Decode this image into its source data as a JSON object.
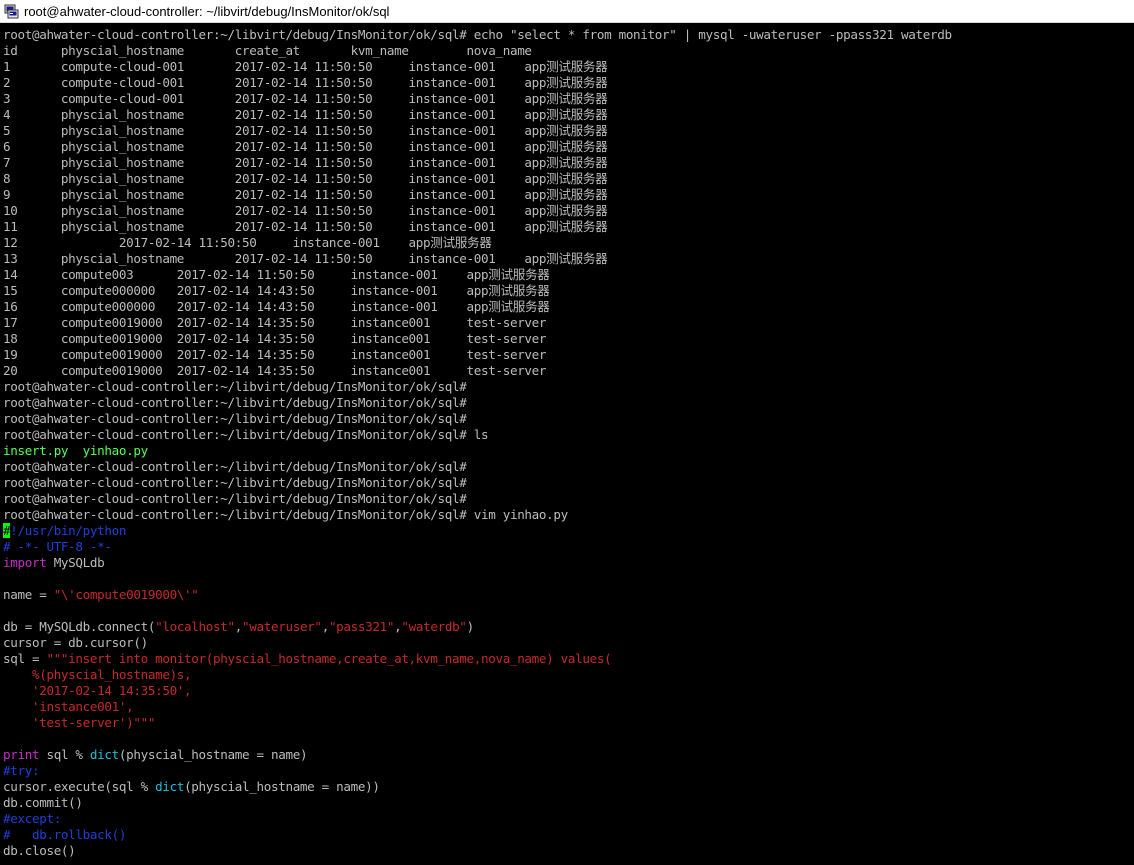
{
  "window": {
    "title": "root@ahwater-cloud-controller: ~/libvirt/debug/InsMonitor/ok/sql",
    "icon": "putty-terminal-icon"
  },
  "colors": {
    "background": "#000000",
    "default": "#bbbbbb",
    "green": "#54ff54",
    "comment": "#1f3fd6",
    "keyword": "#c42fc4",
    "string": "#c42a2a",
    "builtin": "#20bcd6",
    "cursor": "#00ff00"
  },
  "terminal": {
    "lines": [
      [
        {
          "t": "root@ahwater-cloud-controller:~/libvirt/debug/InsMonitor/ok/sql# echo \"select * from monitor\" | mysql -uwateruser -ppass321 waterdb",
          "c": "default"
        }
      ],
      [
        {
          "t": "id      physcial_hostname       create_at       kvm_name        nova_name",
          "c": "default"
        }
      ],
      [
        {
          "t": "1       compute-cloud-001       2017-02-14 11:50:50     instance-001    app测试服务器",
          "c": "default"
        }
      ],
      [
        {
          "t": "2       compute-cloud-001       2017-02-14 11:50:50     instance-001    app测试服务器",
          "c": "default"
        }
      ],
      [
        {
          "t": "3       compute-cloud-001       2017-02-14 11:50:50     instance-001    app测试服务器",
          "c": "default"
        }
      ],
      [
        {
          "t": "4       physcial_hostname       2017-02-14 11:50:50     instance-001    app测试服务器",
          "c": "default"
        }
      ],
      [
        {
          "t": "5       physcial_hostname       2017-02-14 11:50:50     instance-001    app测试服务器",
          "c": "default"
        }
      ],
      [
        {
          "t": "6       physcial_hostname       2017-02-14 11:50:50     instance-001    app测试服务器",
          "c": "default"
        }
      ],
      [
        {
          "t": "7       physcial_hostname       2017-02-14 11:50:50     instance-001    app测试服务器",
          "c": "default"
        }
      ],
      [
        {
          "t": "8       physcial_hostname       2017-02-14 11:50:50     instance-001    app测试服务器",
          "c": "default"
        }
      ],
      [
        {
          "t": "9       physcial_hostname       2017-02-14 11:50:50     instance-001    app测试服务器",
          "c": "default"
        }
      ],
      [
        {
          "t": "10      physcial_hostname       2017-02-14 11:50:50     instance-001    app测试服务器",
          "c": "default"
        }
      ],
      [
        {
          "t": "11      physcial_hostname       2017-02-14 11:50:50     instance-001    app测试服务器",
          "c": "default"
        }
      ],
      [
        {
          "t": "12              2017-02-14 11:50:50     instance-001    app测试服务器",
          "c": "default"
        }
      ],
      [
        {
          "t": "13      physcial_hostname       2017-02-14 11:50:50     instance-001    app测试服务器",
          "c": "default"
        }
      ],
      [
        {
          "t": "14      compute003      2017-02-14 11:50:50     instance-001    app测试服务器",
          "c": "default"
        }
      ],
      [
        {
          "t": "15      compute000000   2017-02-14 14:43:50     instance-001    app测试服务器",
          "c": "default"
        }
      ],
      [
        {
          "t": "16      compute000000   2017-02-14 14:43:50     instance-001    app测试服务器",
          "c": "default"
        }
      ],
      [
        {
          "t": "17      compute0019000  2017-02-14 14:35:50     instance001     test-server",
          "c": "default"
        }
      ],
      [
        {
          "t": "18      compute0019000  2017-02-14 14:35:50     instance001     test-server",
          "c": "default"
        }
      ],
      [
        {
          "t": "19      compute0019000  2017-02-14 14:35:50     instance001     test-server",
          "c": "default"
        }
      ],
      [
        {
          "t": "20      compute0019000  2017-02-14 14:35:50     instance001     test-server",
          "c": "default"
        }
      ],
      [
        {
          "t": "root@ahwater-cloud-controller:~/libvirt/debug/InsMonitor/ok/sql#",
          "c": "default"
        }
      ],
      [
        {
          "t": "root@ahwater-cloud-controller:~/libvirt/debug/InsMonitor/ok/sql#",
          "c": "default"
        }
      ],
      [
        {
          "t": "root@ahwater-cloud-controller:~/libvirt/debug/InsMonitor/ok/sql#",
          "c": "default"
        }
      ],
      [
        {
          "t": "root@ahwater-cloud-controller:~/libvirt/debug/InsMonitor/ok/sql# ls",
          "c": "default"
        }
      ],
      [
        {
          "t": "insert.py  yinhao.py",
          "c": "green"
        }
      ],
      [
        {
          "t": "root@ahwater-cloud-controller:~/libvirt/debug/InsMonitor/ok/sql#",
          "c": "default"
        }
      ],
      [
        {
          "t": "root@ahwater-cloud-controller:~/libvirt/debug/InsMonitor/ok/sql#",
          "c": "default"
        }
      ],
      [
        {
          "t": "root@ahwater-cloud-controller:~/libvirt/debug/InsMonitor/ok/sql#",
          "c": "default"
        }
      ],
      [
        {
          "t": "root@ahwater-cloud-controller:~/libvirt/debug/InsMonitor/ok/sql# vim yinhao.py",
          "c": "default"
        }
      ],
      [
        {
          "t": "#",
          "c": "cursor"
        },
        {
          "t": "!/usr/bin/python",
          "c": "comment"
        }
      ],
      [
        {
          "t": "# -*- UTF-8 -*-",
          "c": "comment"
        }
      ],
      [
        {
          "t": "import",
          "c": "keyword"
        },
        {
          "t": " MySQLdb",
          "c": "default"
        }
      ],
      [
        {
          "t": "",
          "c": "default"
        }
      ],
      [
        {
          "t": "name = ",
          "c": "default"
        },
        {
          "t": "\"\\'compute0019000\\'\"",
          "c": "string"
        }
      ],
      [
        {
          "t": "",
          "c": "default"
        }
      ],
      [
        {
          "t": "db = MySQLdb.connect(",
          "c": "default"
        },
        {
          "t": "\"localhost\"",
          "c": "string"
        },
        {
          "t": ",",
          "c": "default"
        },
        {
          "t": "\"wateruser\"",
          "c": "string"
        },
        {
          "t": ",",
          "c": "default"
        },
        {
          "t": "\"pass321\"",
          "c": "string"
        },
        {
          "t": ",",
          "c": "default"
        },
        {
          "t": "\"waterdb\"",
          "c": "string"
        },
        {
          "t": ")",
          "c": "default"
        }
      ],
      [
        {
          "t": "cursor = db.cursor()",
          "c": "default"
        }
      ],
      [
        {
          "t": "sql = ",
          "c": "default"
        },
        {
          "t": "\"\"\"insert into monitor(physcial_hostname,create_at,kvm_name,nova_name) values(",
          "c": "string"
        }
      ],
      [
        {
          "t": "    %(physcial_hostname)s,",
          "c": "string"
        }
      ],
      [
        {
          "t": "    '2017-02-14 14:35:50',",
          "c": "string"
        }
      ],
      [
        {
          "t": "    'instance001',",
          "c": "string"
        }
      ],
      [
        {
          "t": "    'test-server')\"\"\"",
          "c": "string"
        }
      ],
      [
        {
          "t": "",
          "c": "default"
        }
      ],
      [
        {
          "t": "print",
          "c": "keyword"
        },
        {
          "t": " sql % ",
          "c": "default"
        },
        {
          "t": "dict",
          "c": "builtin"
        },
        {
          "t": "(physcial_hostname = name)",
          "c": "default"
        }
      ],
      [
        {
          "t": "#try:",
          "c": "comment"
        }
      ],
      [
        {
          "t": "cursor.execute(sql % ",
          "c": "default"
        },
        {
          "t": "dict",
          "c": "builtin"
        },
        {
          "t": "(physcial_hostname = name))",
          "c": "default"
        }
      ],
      [
        {
          "t": "db.commit()",
          "c": "default"
        }
      ],
      [
        {
          "t": "#except:",
          "c": "comment"
        }
      ],
      [
        {
          "t": "#   db.rollback()",
          "c": "comment"
        }
      ],
      [
        {
          "t": "db.close()",
          "c": "default"
        }
      ]
    ]
  }
}
